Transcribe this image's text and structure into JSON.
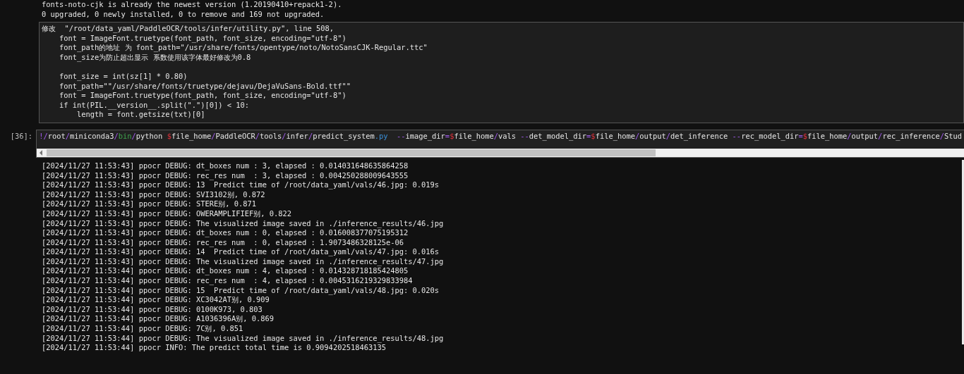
{
  "previous_output": [
    "fonts-noto-cjk is already the newest version (1.20190410+repack1-2).",
    "0 upgraded, 0 newly installed, 0 to remove and 169 not upgraded."
  ],
  "note_cell": {
    "lines": [
      "修改  \"/root/data_yaml/PaddleOCR/tools/infer/utility.py\", line 508,",
      "    font = ImageFont.truetype(font_path, font_size, encoding=\"utf-8\")",
      "    font_path的地址 为 font_path=\"/usr/share/fonts/opentype/noto/NotoSansCJK-Regular.ttc\"",
      "    font_size为防止超出显示 系数使用该字体最好修改为0.8"
    ],
    "lines_after_gap": [
      "    font_size = int(sz[1] * 0.80)",
      "    font_path=\"\"/usr/share/fonts/truetype/dejavu/DejaVuSans-Bold.ttf\"\"",
      "    font = ImageFont.truetype(font_path, font_size, encoding=\"utf-8\")",
      "    if int(PIL.__version__.split(\".\")[0]) < 10:",
      "        length = font.getsize(txt)[0]"
    ]
  },
  "code_cell": {
    "prompt": "[36]:",
    "tokens": [
      {
        "text": "!",
        "kind": "op"
      },
      {
        "text": "/",
        "kind": "op"
      },
      {
        "text": "root",
        "kind": "plain"
      },
      {
        "text": "/",
        "kind": "op"
      },
      {
        "text": "miniconda3",
        "kind": "plain"
      },
      {
        "text": "/",
        "kind": "op"
      },
      {
        "text": "bin",
        "kind": "builtin"
      },
      {
        "text": "/",
        "kind": "op"
      },
      {
        "text": "python ",
        "kind": "plain"
      },
      {
        "text": "$",
        "kind": "var"
      },
      {
        "text": "file_home",
        "kind": "plain"
      },
      {
        "text": "/",
        "kind": "op"
      },
      {
        "text": "PaddleOCR",
        "kind": "plain"
      },
      {
        "text": "/",
        "kind": "op"
      },
      {
        "text": "tools",
        "kind": "plain"
      },
      {
        "text": "/",
        "kind": "op"
      },
      {
        "text": "infer",
        "kind": "plain"
      },
      {
        "text": "/",
        "kind": "op"
      },
      {
        "text": "predict_system",
        "kind": "plain"
      },
      {
        "text": ".py",
        "kind": "ext"
      },
      {
        "text": "  --",
        "kind": "op"
      },
      {
        "text": "image_dir",
        "kind": "plain"
      },
      {
        "text": "=",
        "kind": "op"
      },
      {
        "text": "$",
        "kind": "var"
      },
      {
        "text": "file_home",
        "kind": "plain"
      },
      {
        "text": "/",
        "kind": "op"
      },
      {
        "text": "vals ",
        "kind": "plain"
      },
      {
        "text": "--",
        "kind": "op"
      },
      {
        "text": "det_model_dir",
        "kind": "plain"
      },
      {
        "text": "=",
        "kind": "op"
      },
      {
        "text": "$",
        "kind": "var"
      },
      {
        "text": "file_home",
        "kind": "plain"
      },
      {
        "text": "/",
        "kind": "op"
      },
      {
        "text": "output",
        "kind": "plain"
      },
      {
        "text": "/",
        "kind": "op"
      },
      {
        "text": "det_inference ",
        "kind": "plain"
      },
      {
        "text": "--",
        "kind": "op"
      },
      {
        "text": "rec_model_dir",
        "kind": "plain"
      },
      {
        "text": "=",
        "kind": "op"
      },
      {
        "text": "$",
        "kind": "var"
      },
      {
        "text": "file_home",
        "kind": "plain"
      },
      {
        "text": "/",
        "kind": "op"
      },
      {
        "text": "output",
        "kind": "plain"
      },
      {
        "text": "/",
        "kind": "op"
      },
      {
        "text": "rec_inference",
        "kind": "plain"
      },
      {
        "text": "/",
        "kind": "op"
      },
      {
        "text": "Stud",
        "kind": "plain"
      }
    ]
  },
  "output_lines": [
    "[2024/11/27 11:53:43] ppocr DEBUG: dt_boxes num : 3, elapsed : 0.014031648635864258",
    "[2024/11/27 11:53:43] ppocr DEBUG: rec_res num  : 3, elapsed : 0.004250288009643555",
    "[2024/11/27 11:53:43] ppocr DEBUG: 13  Predict time of /root/data_yaml/vals/46.jpg: 0.019s",
    "[2024/11/27 11:53:43] ppocr DEBUG: SVI3102别, 0.872",
    "[2024/11/27 11:53:43] ppocr DEBUG: STERE别, 0.871",
    "[2024/11/27 11:53:43] ppocr DEBUG: OWERAMPLIFIEF别, 0.822",
    "[2024/11/27 11:53:43] ppocr DEBUG: The visualized image saved in ./inference_results/46.jpg",
    "[2024/11/27 11:53:43] ppocr DEBUG: dt_boxes num : 0, elapsed : 0.016008377075195312",
    "[2024/11/27 11:53:43] ppocr DEBUG: rec_res num  : 0, elapsed : 1.9073486328125e-06",
    "[2024/11/27 11:53:43] ppocr DEBUG: 14  Predict time of /root/data_yaml/vals/47.jpg: 0.016s",
    "[2024/11/27 11:53:43] ppocr DEBUG: The visualized image saved in ./inference_results/47.jpg",
    "[2024/11/27 11:53:44] ppocr DEBUG: dt_boxes num : 4, elapsed : 0.014328718185424805",
    "[2024/11/27 11:53:44] ppocr DEBUG: rec_res num  : 4, elapsed : 0.0045316219329833984",
    "[2024/11/27 11:53:44] ppocr DEBUG: 15  Predict time of /root/data_yaml/vals/48.jpg: 0.020s",
    "[2024/11/27 11:53:44] ppocr DEBUG: XC3042AT别, 0.909",
    "[2024/11/27 11:53:44] ppocr DEBUG: 0100K973, 0.803",
    "[2024/11/27 11:53:44] ppocr DEBUG: A1036396A别, 0.869",
    "[2024/11/27 11:53:44] ppocr DEBUG: 7C别, 0.851",
    "[2024/11/27 11:53:44] ppocr DEBUG: The visualized image saved in ./inference_results/48.jpg",
    "[2024/11/27 11:53:44] ppocr INFO: The predict total time is 0.9094202518463135"
  ]
}
